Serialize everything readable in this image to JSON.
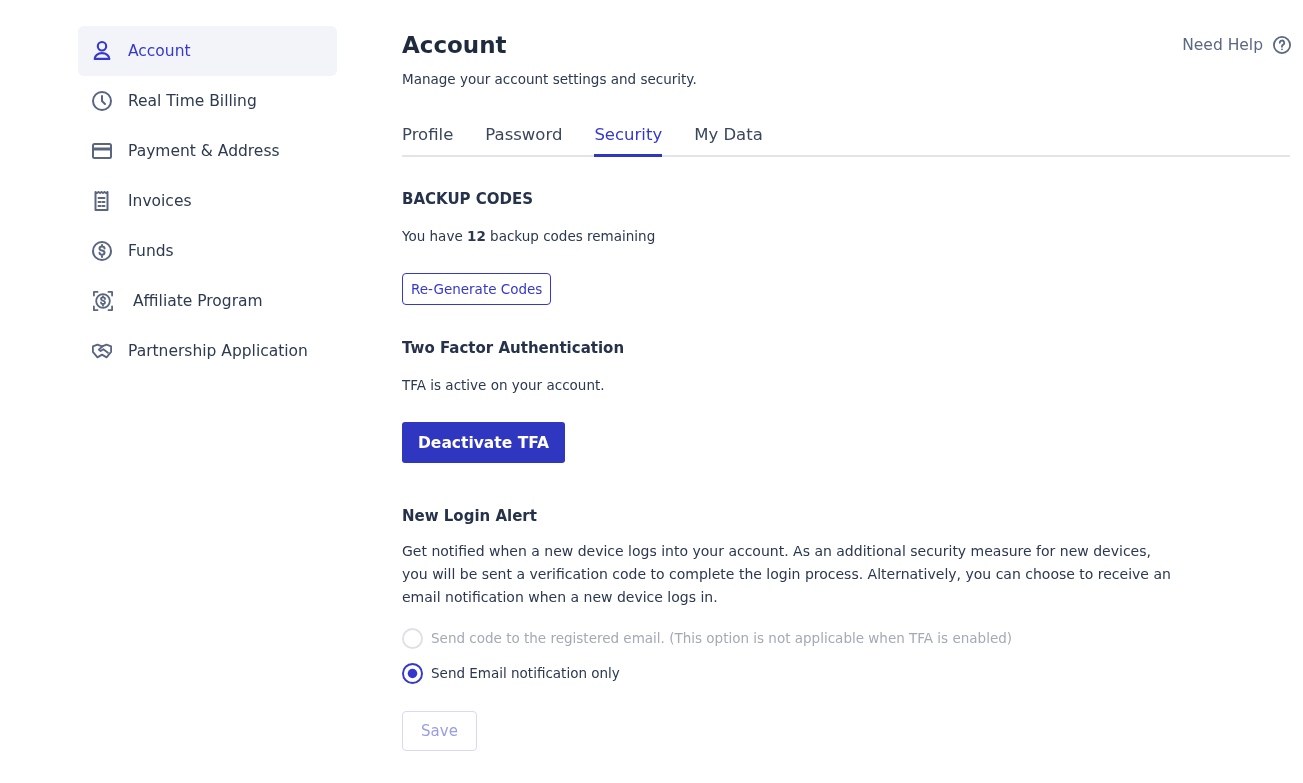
{
  "sidebar": {
    "items": [
      {
        "label": "Account",
        "selected": true
      },
      {
        "label": "Real Time Billing",
        "selected": false
      },
      {
        "label": "Payment & Address",
        "selected": false
      },
      {
        "label": "Invoices",
        "selected": false
      },
      {
        "label": "Funds",
        "selected": false
      },
      {
        "label": "Affiliate Program",
        "selected": false
      },
      {
        "label": "Partnership Application",
        "selected": false
      }
    ]
  },
  "header": {
    "title": "Account",
    "subtitle": "Manage your account settings and security.",
    "help_link": "Need Help"
  },
  "tabs": [
    {
      "label": "Profile",
      "selected": false
    },
    {
      "label": "Password",
      "selected": false
    },
    {
      "label": "Security",
      "selected": true
    },
    {
      "label": "My Data",
      "selected": false
    }
  ],
  "backup_codes": {
    "heading": "BACKUP CODES",
    "text": "You have **12** backup codes remaining",
    "button": "Re-Generate Codes"
  },
  "two_factor": {
    "heading": "Two Factor Authentication",
    "text": "TFA is active on your account.",
    "button": "Deactivate TFA"
  },
  "login_alert": {
    "heading": "New Login Alert",
    "text": "Get notified when a new device logs into your account. As an additional security measure for new devices, you will be sent a verification code to complete the login process. Alternatively, you can choose to receive an email notification when a new device logs in.",
    "options": [
      {
        "label": "Send code to the registered email. (This option is not applicable when TFA is enabled)",
        "selected": false,
        "disabled": true
      },
      {
        "label": "Send Email notification only",
        "selected": true,
        "disabled": false
      }
    ],
    "save_button": {
      "label": "Save",
      "disabled": true
    }
  }
}
